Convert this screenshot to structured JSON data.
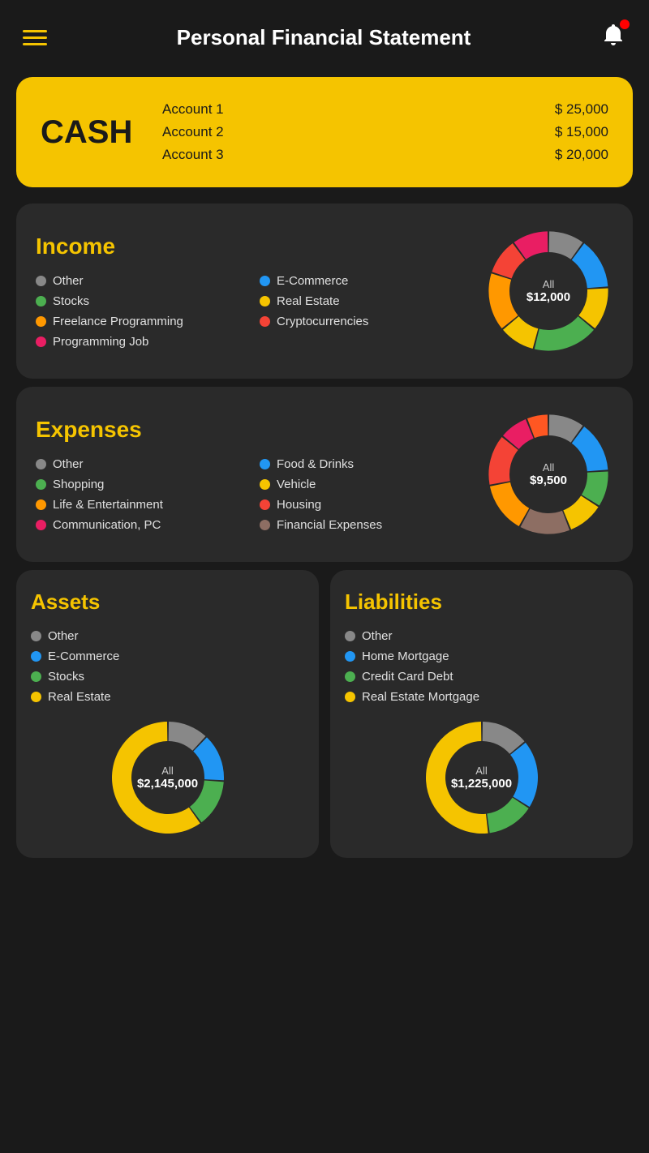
{
  "header": {
    "title": "Personal Financial Statement"
  },
  "cash": {
    "label": "CASH",
    "accounts": [
      {
        "name": "Account 1",
        "value": "$ 25,000"
      },
      {
        "name": "Account 2",
        "value": "$ 15,000"
      },
      {
        "name": "Account 3",
        "value": "$ 20,000"
      }
    ]
  },
  "income": {
    "title": "Income",
    "legend": [
      {
        "label": "Other",
        "color": "#888888"
      },
      {
        "label": "E-Commerce",
        "color": "#2196f3"
      },
      {
        "label": "Stocks",
        "color": "#4caf50"
      },
      {
        "label": "Real Estate",
        "color": "#f5c400"
      },
      {
        "label": "Freelance Programming",
        "color": "#ff9800"
      },
      {
        "label": "Cryptocurrencies",
        "color": "#f44336"
      },
      {
        "label": "Programming Job",
        "color": "#e91e63"
      }
    ],
    "chart": {
      "center_label": "All",
      "center_value": "$12,000",
      "segments": [
        {
          "color": "#888888",
          "pct": 10
        },
        {
          "color": "#2196f3",
          "pct": 14
        },
        {
          "color": "#f5c400",
          "pct": 12
        },
        {
          "color": "#4caf50",
          "pct": 18
        },
        {
          "color": "#f5c400",
          "pct": 10
        },
        {
          "color": "#ff9800",
          "pct": 16
        },
        {
          "color": "#f44336",
          "pct": 10
        },
        {
          "color": "#e91e63",
          "pct": 10
        }
      ]
    }
  },
  "expenses": {
    "title": "Expenses",
    "legend": [
      {
        "label": "Other",
        "color": "#888888"
      },
      {
        "label": "Food & Drinks",
        "color": "#2196f3"
      },
      {
        "label": "Shopping",
        "color": "#4caf50"
      },
      {
        "label": "Vehicle",
        "color": "#f5c400"
      },
      {
        "label": "Life & Entertainment",
        "color": "#ff9800"
      },
      {
        "label": "Housing",
        "color": "#f44336"
      },
      {
        "label": "Communication, PC",
        "color": "#e91e63"
      },
      {
        "label": "Financial Expenses",
        "color": "#8d6e63"
      }
    ],
    "chart": {
      "center_label": "All",
      "center_value": "$9,500",
      "segments": [
        {
          "color": "#888888",
          "pct": 10
        },
        {
          "color": "#2196f3",
          "pct": 14
        },
        {
          "color": "#4caf50",
          "pct": 10
        },
        {
          "color": "#f5c400",
          "pct": 10
        },
        {
          "color": "#8d6e63",
          "pct": 14
        },
        {
          "color": "#ff9800",
          "pct": 14
        },
        {
          "color": "#f44336",
          "pct": 14
        },
        {
          "color": "#e91e63",
          "pct": 8
        },
        {
          "color": "#ff5722",
          "pct": 6
        }
      ]
    }
  },
  "assets": {
    "title": "Assets",
    "legend": [
      {
        "label": "Other",
        "color": "#888888"
      },
      {
        "label": "E-Commerce",
        "color": "#2196f3"
      },
      {
        "label": "Stocks",
        "color": "#4caf50"
      },
      {
        "label": "Real Estate",
        "color": "#f5c400"
      }
    ],
    "chart": {
      "center_label": "All",
      "center_value": "$2,145,000",
      "segments": [
        {
          "color": "#888888",
          "pct": 12
        },
        {
          "color": "#2196f3",
          "pct": 14
        },
        {
          "color": "#4caf50",
          "pct": 14
        },
        {
          "color": "#f5c400",
          "pct": 60
        }
      ]
    }
  },
  "liabilities": {
    "title": "Liabilities",
    "legend": [
      {
        "label": "Other",
        "color": "#888888"
      },
      {
        "label": "Home Mortgage",
        "color": "#2196f3"
      },
      {
        "label": "Credit Card Debt",
        "color": "#4caf50"
      },
      {
        "label": "Real Estate Mortgage",
        "color": "#f5c400"
      }
    ],
    "chart": {
      "center_label": "All",
      "center_value": "$1,225,000",
      "segments": [
        {
          "color": "#888888",
          "pct": 14
        },
        {
          "color": "#2196f3",
          "pct": 20
        },
        {
          "color": "#4caf50",
          "pct": 14
        },
        {
          "color": "#f5c400",
          "pct": 52
        }
      ]
    }
  }
}
